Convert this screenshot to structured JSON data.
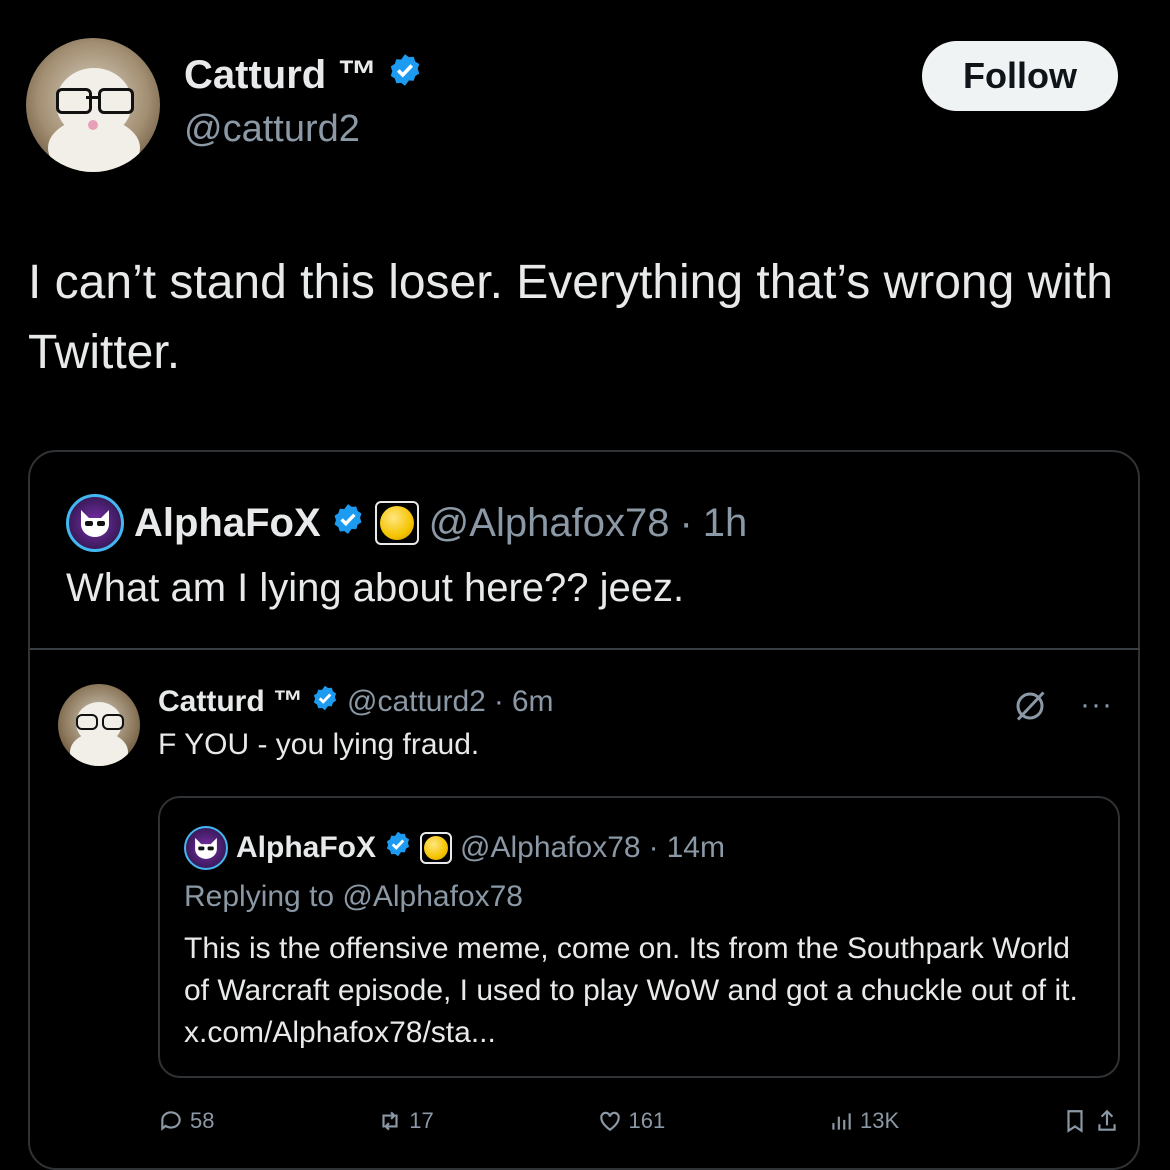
{
  "main": {
    "author_name": "Catturd ™",
    "author_handle": "@catturd2",
    "follow_label": "Follow",
    "text": "I can’t stand this loser. Everything that’s wrong with Twitter."
  },
  "quote": {
    "author_name": "AlphaFoX",
    "author_handle": "@Alphafox78",
    "separator": "·",
    "time": "1h",
    "text": "What am I lying about here?? jeez."
  },
  "inner_tweet": {
    "author_name": "Catturd ™",
    "author_handle": "@catturd2",
    "separator": "·",
    "time": "6m",
    "text": "F YOU - you lying fraud.",
    "more_label": "···"
  },
  "inner_quote": {
    "author_name": "AlphaFoX",
    "author_handle": "@Alphafox78",
    "separator": "·",
    "time": "14m",
    "replying_to": "Replying to @Alphafox78",
    "text": "This is the offensive meme, come on. Its from the Southpark World of Warcraft episode, I used to play WoW and got a chuckle out of it. x.com/Alphafox78/sta..."
  },
  "actions": {
    "replies": "58",
    "reposts": "17",
    "likes": "161",
    "views": "13K"
  },
  "colors": {
    "background": "#000000",
    "verified_blue": "#1d9bf0",
    "muted_text": "#8b98a5",
    "border": "#2f3336"
  }
}
